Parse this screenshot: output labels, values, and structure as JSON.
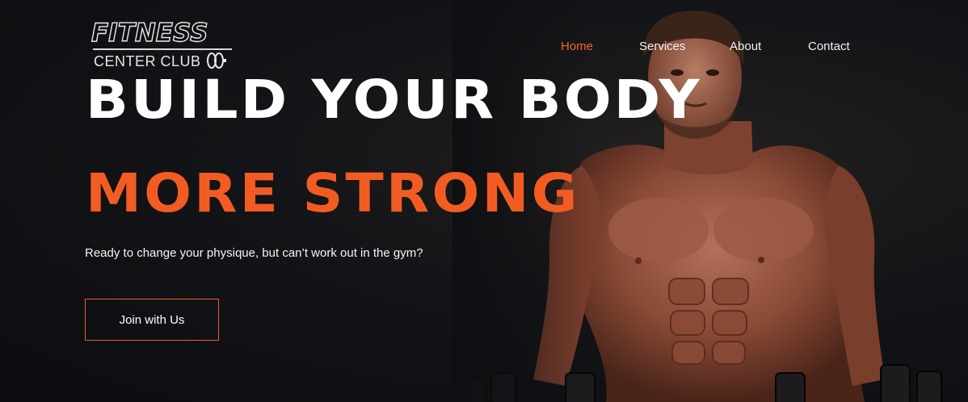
{
  "brand": {
    "title": "FITNESS",
    "subtitle": "CENTER CLUB",
    "logo_icon": "dumbbell-plate-icon"
  },
  "nav": {
    "items": [
      {
        "label": "Home",
        "active": true
      },
      {
        "label": "Services",
        "active": false
      },
      {
        "label": "About",
        "active": false
      },
      {
        "label": "Contact",
        "active": false
      }
    ]
  },
  "hero": {
    "headline_line1": "BUILD YOUR BODY",
    "headline_line2": "MORE STRONG",
    "tagline": "Ready to change your physique, but can’t work out in the gym?",
    "cta_label": "Join with Us",
    "image": "shirtless-athlete-with-dumbbells"
  },
  "colors": {
    "accent": "#f25c22",
    "background": "#0e0f12",
    "text": "#ffffff"
  }
}
